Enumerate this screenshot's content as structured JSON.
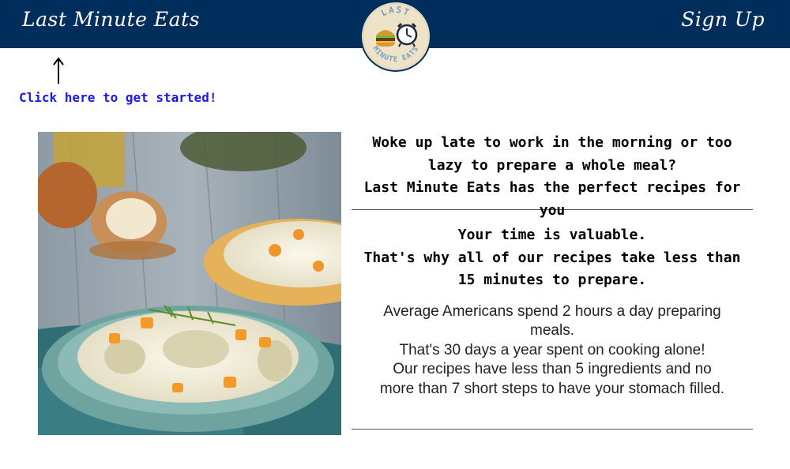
{
  "header": {
    "brand": "Last Minute Eats",
    "signup_label": "Sign Up",
    "logo_text_top": "LAST",
    "logo_text_bottom": "MINUTE EATS",
    "bar_color": "#002e5c"
  },
  "cta": {
    "label": "Click here to get started!",
    "color": "#1a1ae6"
  },
  "hero_image": {
    "subject": "plate of rice with artichokes, carrots and dill on a teal plate"
  },
  "headline": {
    "line1": "Woke up late to work in the morning or too lazy to prepare a whole meal?",
    "line2": "Last Minute Eats has the perfect recipes for you"
  },
  "value_prop": {
    "line1": "Your time is valuable.",
    "line2": "That's why all of our recipes take less than 15 minutes to prepare."
  },
  "description": {
    "line1": "Average Americans spend 2 hours a day preparing meals.",
    "line2": "That's 30 days a year spent on cooking alone!",
    "line3": "Our recipes have less than 5 ingredients and no more than 7 short steps to have your stomach filled."
  }
}
